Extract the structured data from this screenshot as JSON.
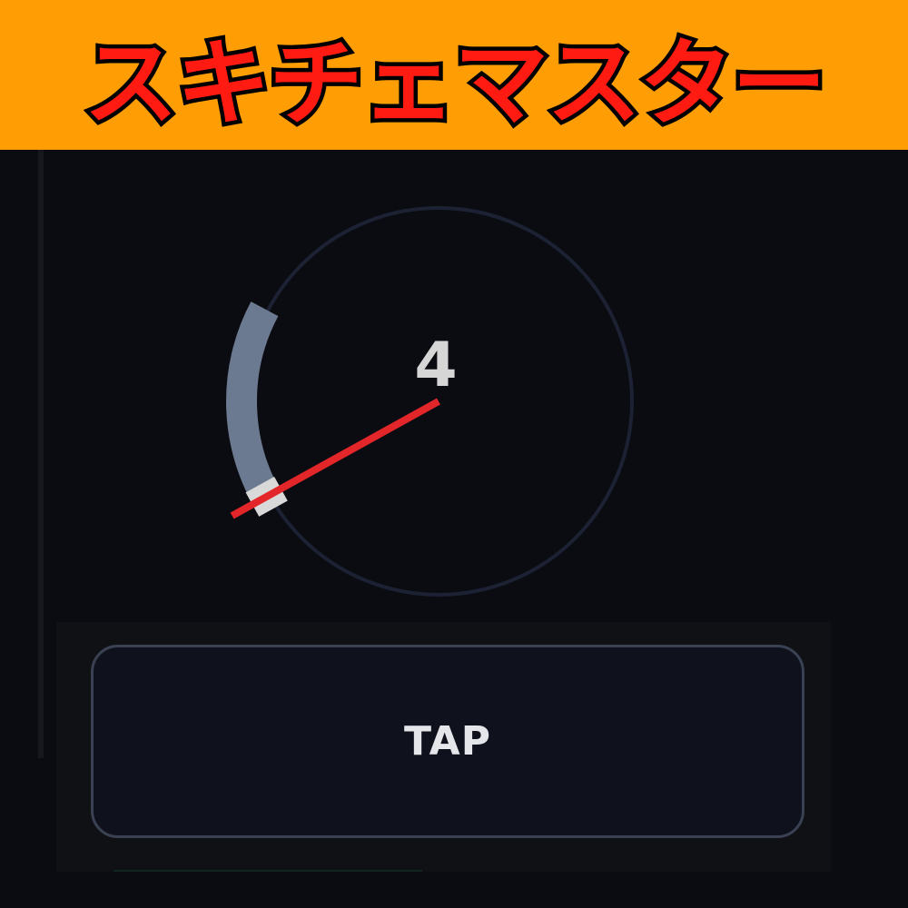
{
  "title": "スキチェマスター",
  "gauge": {
    "count": "4",
    "success_zone": {
      "start_deg": 238,
      "end_deg": 298
    },
    "target_marker_deg": 241,
    "needle_deg": 241,
    "colors": {
      "ring": "#1c2233",
      "zone": "#6b7a90",
      "marker": "#d9d9d9",
      "needle": "#e2262a",
      "count_text": "#d6d6d6"
    }
  },
  "button": {
    "label": "TAP"
  },
  "colors": {
    "banner": "#ff9e04",
    "title_fill": "#ff1a12",
    "background": "#0b0c11"
  }
}
